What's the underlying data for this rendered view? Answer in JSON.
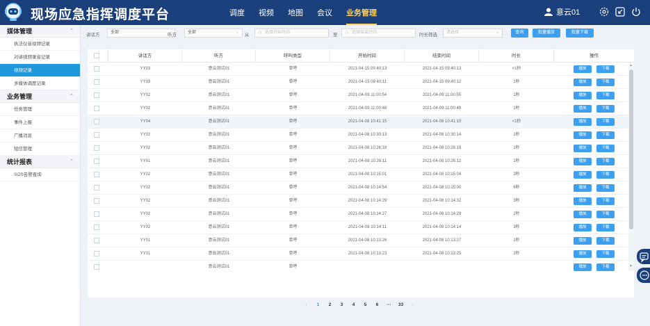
{
  "header": {
    "title": "现场应急指挥调度平台",
    "nav": [
      "调度",
      "视频",
      "地图",
      "会议",
      "业务管理"
    ],
    "active_nav": 4,
    "user_name": "意云01",
    "logo_icon": "robot-avatar-icon",
    "icons": [
      "gear-icon",
      "minimize-icon",
      "power-icon"
    ]
  },
  "sidebar": {
    "groups": [
      {
        "title": "媒体管理",
        "items": [
          "执法仪音视频记录",
          "对讲视频录音记录",
          "视频记录",
          "多媒体调度记录"
        ]
      },
      {
        "title": "业务管理",
        "items": [
          "任务管理",
          "事件上报",
          "广播消息",
          "短信管理"
        ]
      },
      {
        "title": "统计报表",
        "items": [
          "SOS告警查询"
        ]
      }
    ],
    "active_item": "视频记录"
  },
  "filters": {
    "caller_label": "讲话方",
    "caller_value": "全部",
    "callee_label": "听方",
    "callee_value": "全部",
    "from_label": "从",
    "from_placeholder": "选择开始时间",
    "to_label": "至",
    "to_placeholder": "选择结束时间",
    "duration_label": "时长筛选",
    "duration_placeholder": "请选择",
    "search_button": "查询",
    "batch_play_button": "批量播放",
    "batch_download_button": "批量下载"
  },
  "table": {
    "columns": [
      "讲话方",
      "听方",
      "呼叫类型",
      "开始时间",
      "结束时间",
      "时长",
      "操作"
    ],
    "play_label": "播放",
    "download_label": "下载",
    "rows": [
      {
        "caller": "YY03",
        "callee": "意云测试01",
        "type": "单呼",
        "start": "2021-04-15 09:40:13",
        "end": "2021-04-15 09:40:13",
        "duration": "<1秒"
      },
      {
        "caller": "YY03",
        "callee": "意云测试01",
        "type": "单呼",
        "start": "2021-04-15 09:40:11",
        "end": "2021-04-15 09:40:12",
        "duration": "1秒"
      },
      {
        "caller": "YY02",
        "callee": "意云测试01",
        "type": "单呼",
        "start": "2021-04-09 11:00:54",
        "end": "2021-04-09 11:00:55",
        "duration": "1秒"
      },
      {
        "caller": "YY02",
        "callee": "意云测试01",
        "type": "单呼",
        "start": "2021-04-09 11:00:48",
        "end": "2021-04-09 11:00:49",
        "duration": "1秒"
      },
      {
        "caller": "YY04",
        "callee": "意云测试01",
        "type": "单呼",
        "start": "2021-04-08 10:41:15",
        "end": "2021-04-08 10:41:15",
        "duration": "<1秒"
      },
      {
        "caller": "YY02",
        "callee": "意云测试01",
        "type": "单呼",
        "start": "2021-04-08 10:30:13",
        "end": "2021-04-08 10:30:14",
        "duration": "1秒"
      },
      {
        "caller": "YY02",
        "callee": "意云测试01",
        "type": "单呼",
        "start": "2021-04-08 10:26:18",
        "end": "2021-04-08 10:26:19",
        "duration": "1秒"
      },
      {
        "caller": "YY01",
        "callee": "意云测试01",
        "type": "单呼",
        "start": "2021-04-08 10:26:11",
        "end": "2021-04-08 10:26:12",
        "duration": "1秒"
      },
      {
        "caller": "YY02",
        "callee": "意云测试01",
        "type": "单呼",
        "start": "2021-04-08 10:15:01",
        "end": "2021-04-08 10:15:04",
        "duration": "3秒"
      },
      {
        "caller": "YY02",
        "callee": "意云测试01",
        "type": "单呼",
        "start": "2021-04-08 10:14:54",
        "end": "2021-04-08 10:15:00",
        "duration": "6秒"
      },
      {
        "caller": "YY02",
        "callee": "意云测试01",
        "type": "单呼",
        "start": "2021-04-08 10:14:29",
        "end": "2021-04-08 10:14:32",
        "duration": "3秒"
      },
      {
        "caller": "YY02",
        "callee": "意云测试01",
        "type": "单呼",
        "start": "2021-04-08 10:14:27",
        "end": "2021-04-08 10:14:29",
        "duration": "2秒"
      },
      {
        "caller": "YY02",
        "callee": "意云测试01",
        "type": "单呼",
        "start": "2021-04-08 10:14:11",
        "end": "2021-04-08 10:14:14",
        "duration": "3秒"
      },
      {
        "caller": "YY01",
        "callee": "意云测试01",
        "type": "单呼",
        "start": "2021-04-08 10:13:26",
        "end": "2021-04-08 10:13:27",
        "duration": "1秒"
      },
      {
        "caller": "YY01",
        "callee": "意云测试01",
        "type": "单呼",
        "start": "2021-04-08 10:13:23",
        "end": "2021-04-08 10:13:25",
        "duration": "2秒"
      },
      {
        "caller": "",
        "callee": "意云测试01",
        "type": "单呼",
        "start": "",
        "end": "",
        "duration": ""
      }
    ]
  },
  "pagination": {
    "prev": "‹",
    "pages": [
      "1",
      "2",
      "3",
      "4",
      "5",
      "6",
      "···",
      "33"
    ],
    "next": "›",
    "active": "1"
  },
  "colors": {
    "header_bg": "#1b3f7a",
    "accent": "#1f97dc",
    "button": "#3d9ff0",
    "active_nav": "#ffd35c"
  }
}
